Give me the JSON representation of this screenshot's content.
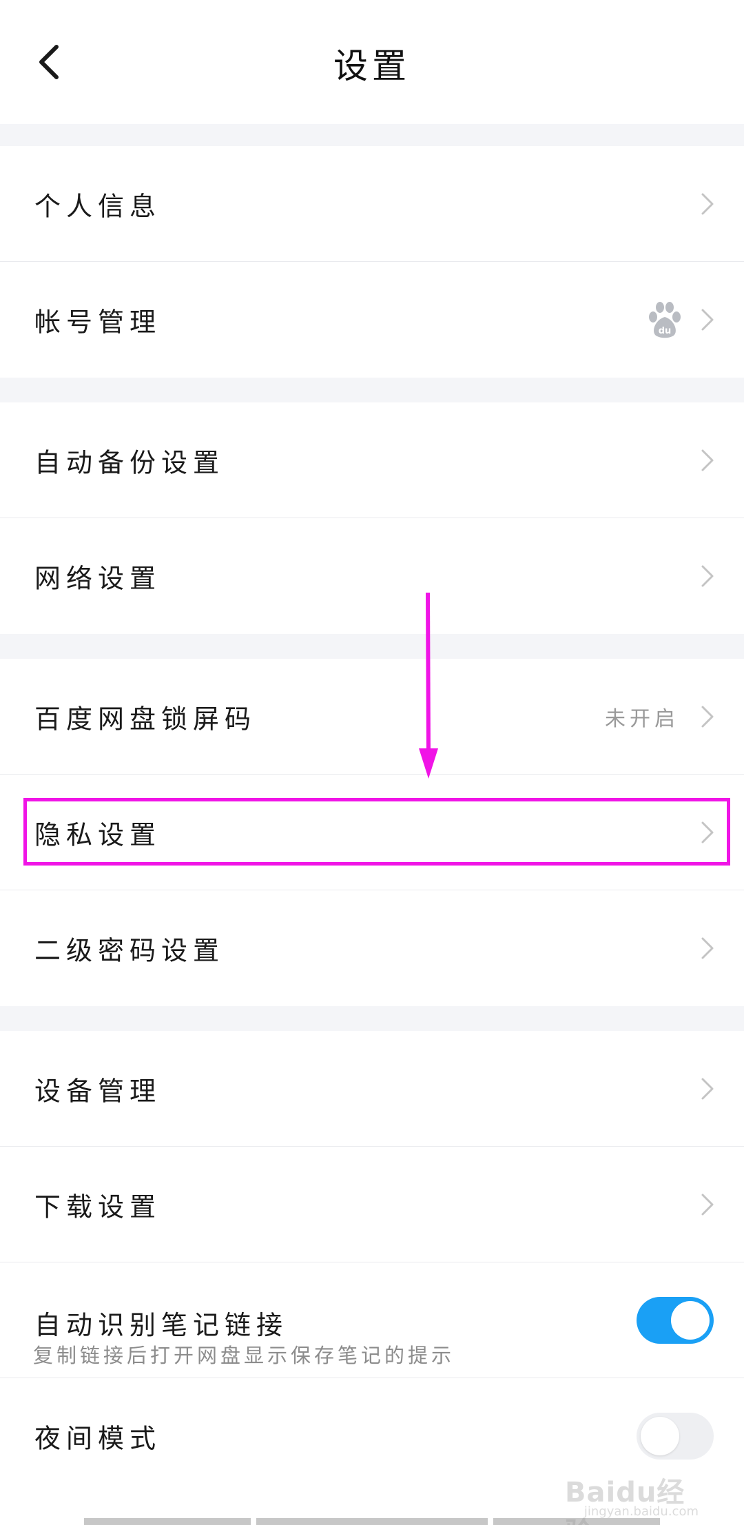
{
  "header": {
    "title": "设置"
  },
  "sections": {
    "account": {
      "personal_info": "个人信息",
      "account_management": "帐号管理"
    },
    "backup": {
      "auto_backup": "自动备份设置",
      "network": "网络设置"
    },
    "security": {
      "lock_screen_code": "百度网盘锁屏码",
      "lock_screen_status": "未开启",
      "privacy": "隐私设置",
      "secondary_password": "二级密码设置"
    },
    "general": {
      "device_management": "设备管理",
      "download_settings": "下载设置",
      "auto_detect_notes": {
        "label": "自动识别笔记链接",
        "description": "复制链接后打开网盘显示保存笔记的提示",
        "enabled": true
      },
      "night_mode": {
        "label": "夜间模式",
        "enabled": false
      }
    }
  },
  "watermark": {
    "text": "Baidu经验",
    "sub": "jingyan.baidu.com"
  },
  "colors": {
    "accent_toggle": "#1aa0f5",
    "highlight": "#f014e6",
    "separator": "#f4f5f8"
  },
  "icons": {
    "back": "chevron-left-icon",
    "row_arrow": "chevron-right-icon",
    "baidu": "baidu-paw-icon"
  }
}
